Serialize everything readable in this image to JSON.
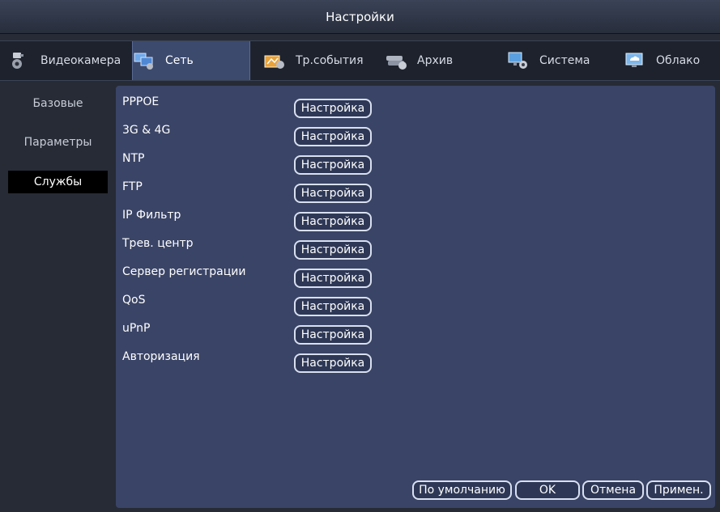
{
  "window": {
    "title": "Настройки"
  },
  "tabs": [
    {
      "label": "Видеокамера",
      "icon": "camera-gear-icon",
      "active": false
    },
    {
      "label": "Сеть",
      "icon": "network-monitors-icon",
      "active": true
    },
    {
      "label": "Тр.события",
      "icon": "alarm-events-icon",
      "active": false
    },
    {
      "label": "Архив",
      "icon": "storage-archive-icon",
      "active": false
    },
    {
      "label": "Система",
      "icon": "system-gear-icon",
      "active": false
    },
    {
      "label": "Облако",
      "icon": "cloud-monitor-icon",
      "active": false
    }
  ],
  "sidebar": {
    "items": [
      {
        "label": "Базовые"
      },
      {
        "label": "Параметры"
      },
      {
        "label": "Службы",
        "active": true
      }
    ]
  },
  "services": [
    {
      "label": "PPPOE",
      "button": "Настройка"
    },
    {
      "label": "3G & 4G",
      "button": "Настройка"
    },
    {
      "label": "NTP",
      "button": "Настройка"
    },
    {
      "label": "FTP",
      "button": "Настройка"
    },
    {
      "label": "IP Фильтр",
      "button": "Настройка"
    },
    {
      "label": "Трев. центр",
      "button": "Настройка"
    },
    {
      "label": "Сервер регистрации",
      "button": "Настройка"
    },
    {
      "label": "QoS",
      "button": "Настройка"
    },
    {
      "label": "uPnP",
      "button": "Настройка"
    },
    {
      "label": "Авторизация",
      "button": "Настройка"
    }
  ],
  "footer": {
    "default_label": "По умолчанию",
    "ok_label": "OK",
    "cancel_label": "Отмена",
    "apply_label": "Примен."
  },
  "colors": {
    "panel": "#3a4466",
    "active_tab": "#3c4a6e",
    "active_sidebar": "#000000",
    "button_border": "#d8e0f0"
  }
}
